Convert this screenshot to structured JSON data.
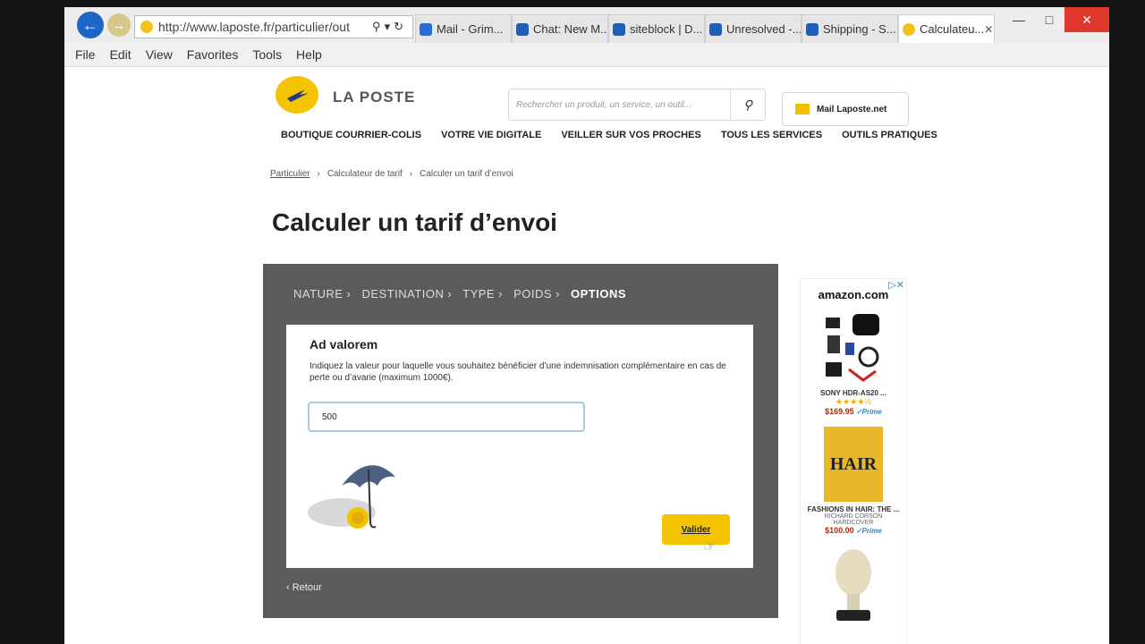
{
  "browser": {
    "url": "http://www.laposte.fr/particulier/out",
    "tabs": [
      {
        "label": "Mail - Grim..."
      },
      {
        "label": "Chat: New M..."
      },
      {
        "label": "siteblock | D..."
      },
      {
        "label": "Unresolved -..."
      },
      {
        "label": "Shipping - S..."
      },
      {
        "label": "Calculateu..."
      }
    ],
    "menu": [
      "File",
      "Edit",
      "View",
      "Favorites",
      "Tools",
      "Help"
    ]
  },
  "header": {
    "logo_text": "LA POSTE",
    "search_placeholder": "Rechercher un produit, un service, un outil...",
    "mail_label": "Mail Laposte.net"
  },
  "nav": [
    "BOUTIQUE COURRIER-COLIS",
    "VOTRE VIE DIGITALE",
    "VEILLER SUR VOS PROCHES",
    "TOUS LES SERVICES",
    "OUTILS PRATIQUES"
  ],
  "breadcrumb": [
    "Particulier",
    "Calculateur de tarif",
    "Calculer un tarif d’envoi"
  ],
  "page_title": "Calculer un tarif d’envoi",
  "steps": [
    "NATURE",
    "DESTINATION",
    "TYPE",
    "POIDS",
    "OPTIONS"
  ],
  "calc": {
    "section_title": "Ad valorem",
    "description": "Indiquez la valeur pour laquelle vous souhaitez bénéficier d’une indemnisation complémentaire en cas de perte ou d’avarie (maximum 1000€).",
    "value": "500",
    "submit_label": "Valider",
    "back_label": "‹ Retour"
  },
  "ads": {
    "brand": "amazon.com",
    "items": [
      {
        "title": "SONY HDR-AS20 ...",
        "stars": "★★★★½",
        "price": "$169.95",
        "prime": "✓Prime"
      },
      {
        "title": "FASHIONS IN HAIR: THE ...",
        "sub1": "RICHARD CORSON",
        "sub2": "HARDCOVER",
        "price": "$100.00",
        "prime": "✓Prime",
        "cover_text": "HAIR"
      }
    ]
  },
  "colors": {
    "laposte_yellow": "#f5c400",
    "panel_dark": "#5b5b5b",
    "ie_blue": "#1d66c7",
    "close_red": "#e0372d"
  }
}
